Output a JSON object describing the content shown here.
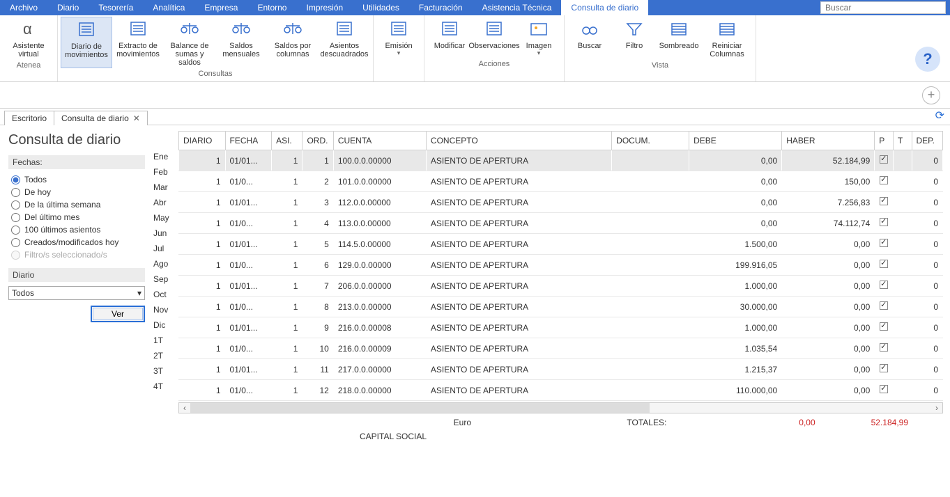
{
  "menubar": {
    "items": [
      "Archivo",
      "Diario",
      "Tesorería",
      "Analítica",
      "Empresa",
      "Entorno",
      "Impresión",
      "Utilidades",
      "Facturación",
      "Asistencia Técnica",
      "Consulta de diario"
    ],
    "active_index": 10,
    "search_placeholder": "Buscar"
  },
  "ribbon": {
    "groups": [
      {
        "label": "Atenea",
        "buttons": [
          {
            "label": "Asistente virtual",
            "icon": "alpha-icon"
          }
        ]
      },
      {
        "label": "Consultas",
        "buttons": [
          {
            "label": "Diario de movimientos",
            "icon": "doc-dh-icon",
            "selected": true
          },
          {
            "label": "Extracto de movimientos",
            "icon": "doc-dh2-icon"
          },
          {
            "label": "Balance de sumas y saldos",
            "icon": "scales-icon"
          },
          {
            "label": "Saldos mensuales",
            "icon": "scales-cal-icon"
          },
          {
            "label": "Saldos por columnas",
            "icon": "scales-cols-icon"
          },
          {
            "label": "Asientos descuadrados",
            "icon": "doc-search-icon"
          }
        ]
      },
      {
        "label": "",
        "buttons": [
          {
            "label": "Emisión",
            "icon": "doc-lines-icon",
            "dropdown": true
          }
        ]
      },
      {
        "label": "Acciones",
        "buttons": [
          {
            "label": "Modificar",
            "icon": "doc-edit-icon"
          },
          {
            "label": "Observaciones",
            "icon": "doc-note-icon"
          },
          {
            "label": "Imagen",
            "icon": "image-icon",
            "dropdown": true
          }
        ]
      },
      {
        "label": "Vista",
        "buttons": [
          {
            "label": "Buscar",
            "icon": "binocular-icon"
          },
          {
            "label": "Filtro",
            "icon": "funnel-icon"
          },
          {
            "label": "Sombreado",
            "icon": "rows-icon"
          },
          {
            "label": "Reiniciar Columnas",
            "icon": "grid-reset-icon"
          }
        ]
      }
    ]
  },
  "tabs": [
    {
      "label": "Escritorio",
      "closable": false
    },
    {
      "label": "Consulta de diario",
      "closable": true
    }
  ],
  "page": {
    "title": "Consulta de diario"
  },
  "fechas": {
    "title": "Fechas:",
    "options": [
      {
        "label": "Todos",
        "checked": true
      },
      {
        "label": "De hoy"
      },
      {
        "label": "De la última semana"
      },
      {
        "label": "Del último mes"
      },
      {
        "label": "100 últimos asientos"
      },
      {
        "label": "Creados/modificados hoy"
      },
      {
        "label": "Filtro/s seleccionado/s",
        "disabled": true
      }
    ]
  },
  "diario": {
    "title": "Diario",
    "selected": "Todos",
    "button": "Ver"
  },
  "months": [
    "Ene",
    "Feb",
    "Mar",
    "Abr",
    "May",
    "Jun",
    "Jul",
    "Ago",
    "Sep",
    "Oct",
    "Nov",
    "Dic",
    "1T",
    "2T",
    "3T",
    "4T"
  ],
  "grid": {
    "headers": [
      "DIARIO",
      "FECHA",
      "ASI.",
      "ORD.",
      "CUENTA",
      "CONCEPTO",
      "DOCUM.",
      "DEBE",
      "HABER",
      "P",
      "T",
      "DEP."
    ],
    "rows": [
      {
        "diario": "1",
        "fecha": "01/01...",
        "asi": "1",
        "ord": "1",
        "cuenta": "100.0.0.00000",
        "concepto": "ASIENTO DE APERTURA",
        "docum": "",
        "debe": "0,00",
        "haber": "52.184,99",
        "p": true,
        "t": "",
        "dep": "0",
        "sel": true
      },
      {
        "diario": "1",
        "fecha": "01/0...",
        "asi": "1",
        "ord": "2",
        "cuenta": "101.0.0.00000",
        "concepto": "ASIENTO DE APERTURA",
        "docum": "",
        "debe": "0,00",
        "haber": "150,00",
        "p": true,
        "t": "",
        "dep": "0"
      },
      {
        "diario": "1",
        "fecha": "01/01...",
        "asi": "1",
        "ord": "3",
        "cuenta": "112.0.0.00000",
        "concepto": "ASIENTO DE APERTURA",
        "docum": "",
        "debe": "0,00",
        "haber": "7.256,83",
        "p": true,
        "t": "",
        "dep": "0"
      },
      {
        "diario": "1",
        "fecha": "01/0...",
        "asi": "1",
        "ord": "4",
        "cuenta": "113.0.0.00000",
        "concepto": "ASIENTO DE APERTURA",
        "docum": "",
        "debe": "0,00",
        "haber": "74.112,74",
        "p": true,
        "t": "",
        "dep": "0"
      },
      {
        "diario": "1",
        "fecha": "01/01...",
        "asi": "1",
        "ord": "5",
        "cuenta": "114.5.0.00000",
        "concepto": "ASIENTO DE APERTURA",
        "docum": "",
        "debe": "1.500,00",
        "haber": "0,00",
        "p": true,
        "t": "",
        "dep": "0"
      },
      {
        "diario": "1",
        "fecha": "01/0...",
        "asi": "1",
        "ord": "6",
        "cuenta": "129.0.0.00000",
        "concepto": "ASIENTO DE APERTURA",
        "docum": "",
        "debe": "199.916,05",
        "haber": "0,00",
        "p": true,
        "t": "",
        "dep": "0"
      },
      {
        "diario": "1",
        "fecha": "01/01...",
        "asi": "1",
        "ord": "7",
        "cuenta": "206.0.0.00000",
        "concepto": "ASIENTO DE APERTURA",
        "docum": "",
        "debe": "1.000,00",
        "haber": "0,00",
        "p": true,
        "t": "",
        "dep": "0"
      },
      {
        "diario": "1",
        "fecha": "01/0...",
        "asi": "1",
        "ord": "8",
        "cuenta": "213.0.0.00000",
        "concepto": "ASIENTO DE APERTURA",
        "docum": "",
        "debe": "30.000,00",
        "haber": "0,00",
        "p": true,
        "t": "",
        "dep": "0"
      },
      {
        "diario": "1",
        "fecha": "01/01...",
        "asi": "1",
        "ord": "9",
        "cuenta": "216.0.0.00008",
        "concepto": "ASIENTO DE APERTURA",
        "docum": "",
        "debe": "1.000,00",
        "haber": "0,00",
        "p": true,
        "t": "",
        "dep": "0"
      },
      {
        "diario": "1",
        "fecha": "01/0...",
        "asi": "1",
        "ord": "10",
        "cuenta": "216.0.0.00009",
        "concepto": "ASIENTO DE APERTURA",
        "docum": "",
        "debe": "1.035,54",
        "haber": "0,00",
        "p": true,
        "t": "",
        "dep": "0"
      },
      {
        "diario": "1",
        "fecha": "01/01...",
        "asi": "1",
        "ord": "11",
        "cuenta": "217.0.0.00000",
        "concepto": "ASIENTO DE APERTURA",
        "docum": "",
        "debe": "1.215,37",
        "haber": "0,00",
        "p": true,
        "t": "",
        "dep": "0"
      },
      {
        "diario": "1",
        "fecha": "01/0...",
        "asi": "1",
        "ord": "12",
        "cuenta": "218.0.0.00000",
        "concepto": "ASIENTO DE APERTURA",
        "docum": "",
        "debe": "110.000,00",
        "haber": "0,00",
        "p": true,
        "t": "",
        "dep": "0"
      }
    ]
  },
  "footer": {
    "currency": "Euro",
    "detail": "CAPITAL SOCIAL",
    "totals_label": "TOTALES:",
    "debe": "0,00",
    "haber": "52.184,99"
  }
}
